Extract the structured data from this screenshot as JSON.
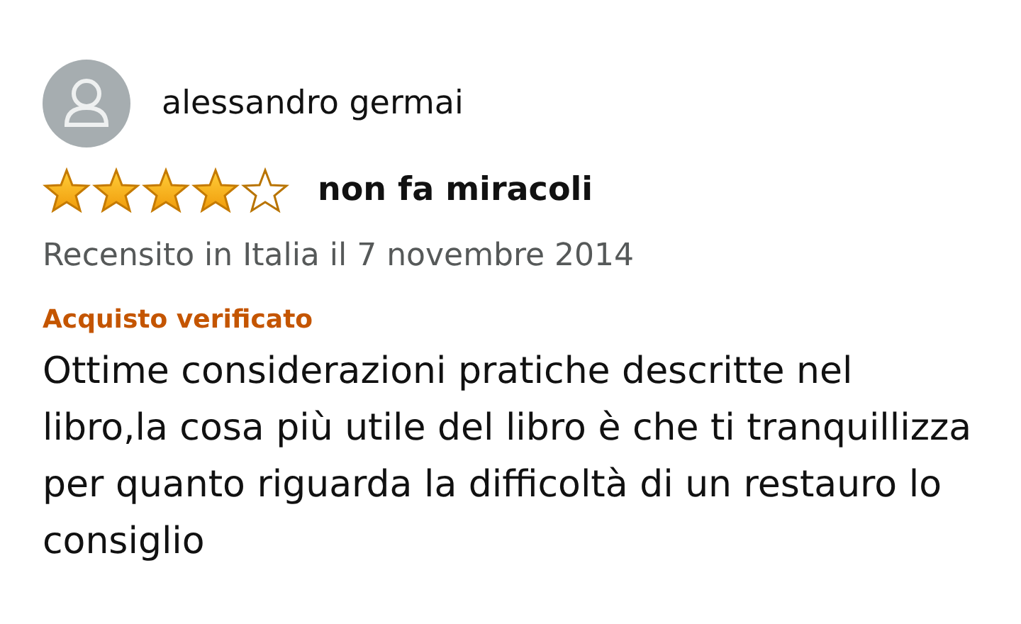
{
  "review": {
    "author": "alessandro germai",
    "stars": 4,
    "title": "non fa miracoli",
    "date": "Recensito in Italia il 7 novembre 2014",
    "badge": "Acquisto verificato",
    "body": "Ottime considerazioni pratiche descritte nel libro,la cosa più utile del libro è che ti tranquillizza per quanto riguarda la difficoltà di un restauro lo consiglio"
  }
}
